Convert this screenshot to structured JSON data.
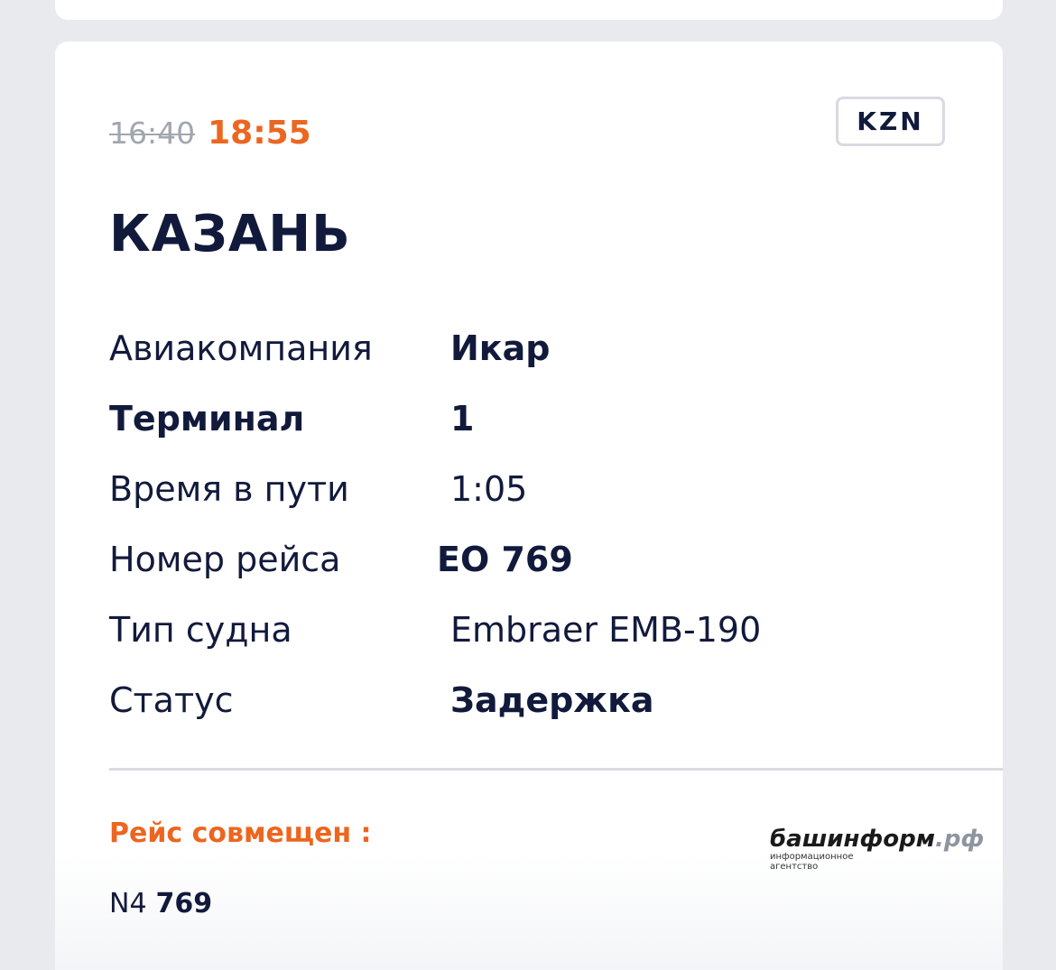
{
  "flight": {
    "scheduled_time": "16:40",
    "expected_time": "18:55",
    "airport_code": "KZN",
    "city": "КАЗАНЬ"
  },
  "details": [
    {
      "label": "Авиакомпания",
      "value": "Икар"
    },
    {
      "label": "Терминал",
      "value": "1"
    },
    {
      "label": "Время в пути",
      "value": "1:05"
    },
    {
      "label": "Номер рейса",
      "value": "EO 769"
    },
    {
      "label": "Тип судна",
      "value": "Embraer EMB-190"
    },
    {
      "label": "Статус",
      "value": "Задержка"
    }
  ],
  "codeshare": {
    "title": "Рейс совмещен :",
    "airline_code": "N4",
    "flight_number": "769"
  },
  "watermark": {
    "name": "башинформ",
    "domain": ".рф",
    "line1": "информационное",
    "line2": "агентство"
  },
  "colors": {
    "accent": "#ec6620",
    "text": "#121a3c",
    "muted": "#a2a6ae"
  }
}
